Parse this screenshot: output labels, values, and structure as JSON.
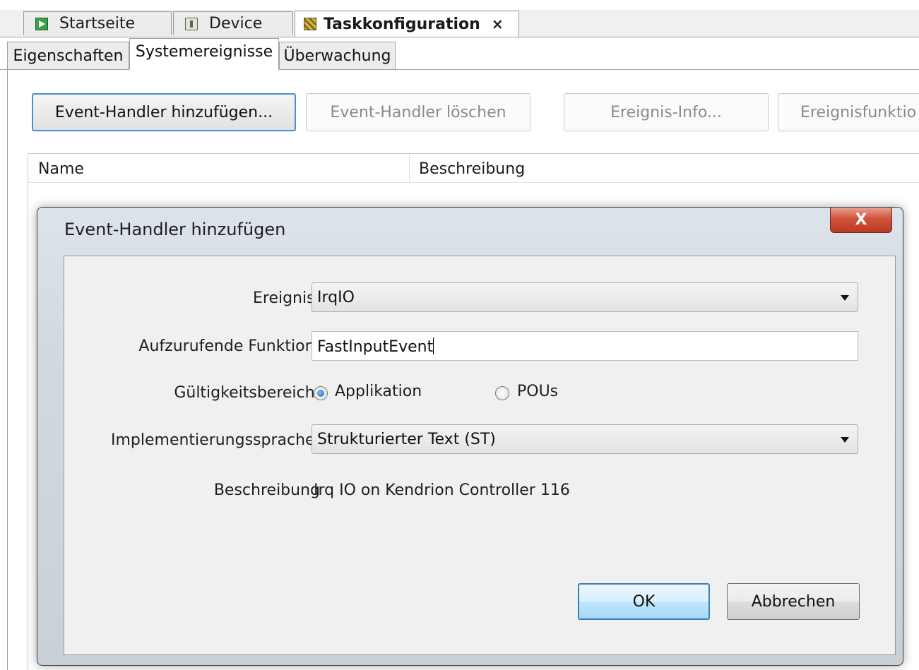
{
  "doc_tabs": [
    {
      "label": "Startseite",
      "icon": "start-page-icon"
    },
    {
      "label": "Device",
      "icon": "device-icon"
    },
    {
      "label": "Taskkonfiguration",
      "icon": "task-configuration-icon",
      "active": true,
      "close": "×"
    }
  ],
  "sub_tabs": [
    {
      "label": "Eigenschaften"
    },
    {
      "label": "Systemereignisse",
      "active": true
    },
    {
      "label": "Überwachung"
    }
  ],
  "toolbar": {
    "add_handler": "Event-Handler hinzufügen...",
    "delete_handler": "Event-Handler löschen",
    "event_info": "Ereignis-Info...",
    "event_function": "Ereignisfunktio"
  },
  "list": {
    "col_name": "Name",
    "col_description": "Beschreibung"
  },
  "dialog": {
    "title": "Event-Handler hinzufügen",
    "close_glyph": "X",
    "event_label": "Ereignis:",
    "event_value": "IrqIO",
    "function_label": "Aufzurufende Funktion:",
    "function_value": "FastInputEvent",
    "scope_label": "Gültigkeitsbereich:",
    "scope_options": [
      {
        "label": "Applikation",
        "selected": true
      },
      {
        "label": "POUs",
        "selected": false
      }
    ],
    "language_label": "Implementierungssprache:",
    "language_value": "Strukturierter Text (ST)",
    "description_label": "Beschreibung",
    "description_value": "Irq IO on Kendrion Controller 116",
    "ok_label": "OK",
    "cancel_label": "Abbrechen"
  },
  "colors": {
    "accent": "#4b8fd3",
    "close_button": "#d0533c"
  }
}
